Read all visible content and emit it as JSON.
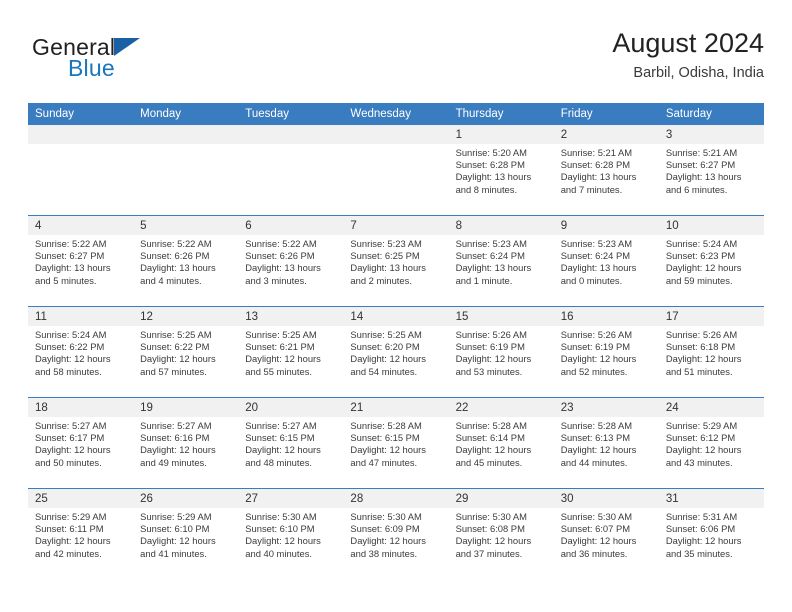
{
  "brand": {
    "name_part1": "General",
    "name_part2": "Blue",
    "logo_icon": "triangle-logo-icon"
  },
  "header": {
    "title": "August 2024",
    "subtitle": "Barbil, Odisha, India"
  },
  "calendar": {
    "weekday_headers": [
      "Sunday",
      "Monday",
      "Tuesday",
      "Wednesday",
      "Thursday",
      "Friday",
      "Saturday"
    ],
    "accent_color": "#3a7cc0",
    "daynum_band_color": "#f1f1f1",
    "weeks": [
      [
        {
          "day": "",
          "lines": []
        },
        {
          "day": "",
          "lines": []
        },
        {
          "day": "",
          "lines": []
        },
        {
          "day": "",
          "lines": []
        },
        {
          "day": "1",
          "lines": [
            "Sunrise: 5:20 AM",
            "Sunset: 6:28 PM",
            "Daylight: 13 hours",
            "and 8 minutes."
          ]
        },
        {
          "day": "2",
          "lines": [
            "Sunrise: 5:21 AM",
            "Sunset: 6:28 PM",
            "Daylight: 13 hours",
            "and 7 minutes."
          ]
        },
        {
          "day": "3",
          "lines": [
            "Sunrise: 5:21 AM",
            "Sunset: 6:27 PM",
            "Daylight: 13 hours",
            "and 6 minutes."
          ]
        }
      ],
      [
        {
          "day": "4",
          "lines": [
            "Sunrise: 5:22 AM",
            "Sunset: 6:27 PM",
            "Daylight: 13 hours",
            "and 5 minutes."
          ]
        },
        {
          "day": "5",
          "lines": [
            "Sunrise: 5:22 AM",
            "Sunset: 6:26 PM",
            "Daylight: 13 hours",
            "and 4 minutes."
          ]
        },
        {
          "day": "6",
          "lines": [
            "Sunrise: 5:22 AM",
            "Sunset: 6:26 PM",
            "Daylight: 13 hours",
            "and 3 minutes."
          ]
        },
        {
          "day": "7",
          "lines": [
            "Sunrise: 5:23 AM",
            "Sunset: 6:25 PM",
            "Daylight: 13 hours",
            "and 2 minutes."
          ]
        },
        {
          "day": "8",
          "lines": [
            "Sunrise: 5:23 AM",
            "Sunset: 6:24 PM",
            "Daylight: 13 hours",
            "and 1 minute."
          ]
        },
        {
          "day": "9",
          "lines": [
            "Sunrise: 5:23 AM",
            "Sunset: 6:24 PM",
            "Daylight: 13 hours",
            "and 0 minutes."
          ]
        },
        {
          "day": "10",
          "lines": [
            "Sunrise: 5:24 AM",
            "Sunset: 6:23 PM",
            "Daylight: 12 hours",
            "and 59 minutes."
          ]
        }
      ],
      [
        {
          "day": "11",
          "lines": [
            "Sunrise: 5:24 AM",
            "Sunset: 6:22 PM",
            "Daylight: 12 hours",
            "and 58 minutes."
          ]
        },
        {
          "day": "12",
          "lines": [
            "Sunrise: 5:25 AM",
            "Sunset: 6:22 PM",
            "Daylight: 12 hours",
            "and 57 minutes."
          ]
        },
        {
          "day": "13",
          "lines": [
            "Sunrise: 5:25 AM",
            "Sunset: 6:21 PM",
            "Daylight: 12 hours",
            "and 55 minutes."
          ]
        },
        {
          "day": "14",
          "lines": [
            "Sunrise: 5:25 AM",
            "Sunset: 6:20 PM",
            "Daylight: 12 hours",
            "and 54 minutes."
          ]
        },
        {
          "day": "15",
          "lines": [
            "Sunrise: 5:26 AM",
            "Sunset: 6:19 PM",
            "Daylight: 12 hours",
            "and 53 minutes."
          ]
        },
        {
          "day": "16",
          "lines": [
            "Sunrise: 5:26 AM",
            "Sunset: 6:19 PM",
            "Daylight: 12 hours",
            "and 52 minutes."
          ]
        },
        {
          "day": "17",
          "lines": [
            "Sunrise: 5:26 AM",
            "Sunset: 6:18 PM",
            "Daylight: 12 hours",
            "and 51 minutes."
          ]
        }
      ],
      [
        {
          "day": "18",
          "lines": [
            "Sunrise: 5:27 AM",
            "Sunset: 6:17 PM",
            "Daylight: 12 hours",
            "and 50 minutes."
          ]
        },
        {
          "day": "19",
          "lines": [
            "Sunrise: 5:27 AM",
            "Sunset: 6:16 PM",
            "Daylight: 12 hours",
            "and 49 minutes."
          ]
        },
        {
          "day": "20",
          "lines": [
            "Sunrise: 5:27 AM",
            "Sunset: 6:15 PM",
            "Daylight: 12 hours",
            "and 48 minutes."
          ]
        },
        {
          "day": "21",
          "lines": [
            "Sunrise: 5:28 AM",
            "Sunset: 6:15 PM",
            "Daylight: 12 hours",
            "and 47 minutes."
          ]
        },
        {
          "day": "22",
          "lines": [
            "Sunrise: 5:28 AM",
            "Sunset: 6:14 PM",
            "Daylight: 12 hours",
            "and 45 minutes."
          ]
        },
        {
          "day": "23",
          "lines": [
            "Sunrise: 5:28 AM",
            "Sunset: 6:13 PM",
            "Daylight: 12 hours",
            "and 44 minutes."
          ]
        },
        {
          "day": "24",
          "lines": [
            "Sunrise: 5:29 AM",
            "Sunset: 6:12 PM",
            "Daylight: 12 hours",
            "and 43 minutes."
          ]
        }
      ],
      [
        {
          "day": "25",
          "lines": [
            "Sunrise: 5:29 AM",
            "Sunset: 6:11 PM",
            "Daylight: 12 hours",
            "and 42 minutes."
          ]
        },
        {
          "day": "26",
          "lines": [
            "Sunrise: 5:29 AM",
            "Sunset: 6:10 PM",
            "Daylight: 12 hours",
            "and 41 minutes."
          ]
        },
        {
          "day": "27",
          "lines": [
            "Sunrise: 5:30 AM",
            "Sunset: 6:10 PM",
            "Daylight: 12 hours",
            "and 40 minutes."
          ]
        },
        {
          "day": "28",
          "lines": [
            "Sunrise: 5:30 AM",
            "Sunset: 6:09 PM",
            "Daylight: 12 hours",
            "and 38 minutes."
          ]
        },
        {
          "day": "29",
          "lines": [
            "Sunrise: 5:30 AM",
            "Sunset: 6:08 PM",
            "Daylight: 12 hours",
            "and 37 minutes."
          ]
        },
        {
          "day": "30",
          "lines": [
            "Sunrise: 5:30 AM",
            "Sunset: 6:07 PM",
            "Daylight: 12 hours",
            "and 36 minutes."
          ]
        },
        {
          "day": "31",
          "lines": [
            "Sunrise: 5:31 AM",
            "Sunset: 6:06 PM",
            "Daylight: 12 hours",
            "and 35 minutes."
          ]
        }
      ]
    ]
  }
}
